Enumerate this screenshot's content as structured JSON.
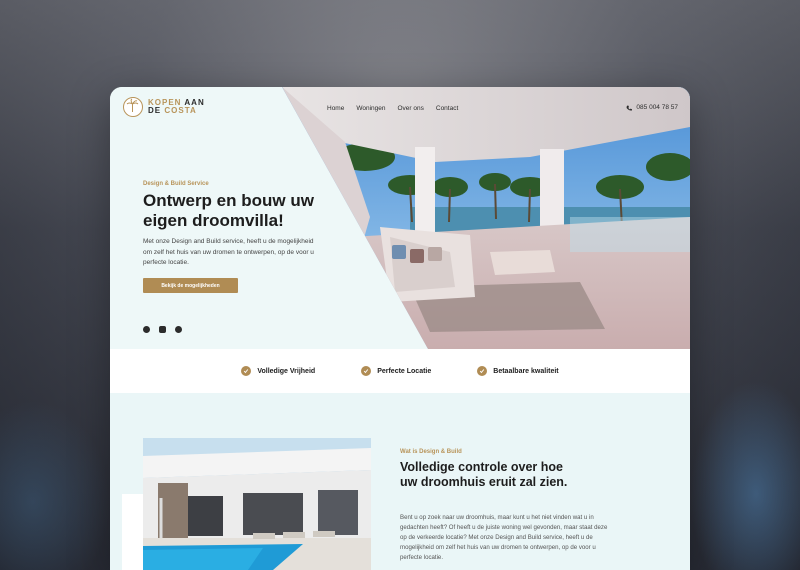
{
  "brand": {
    "line1_light": "KOPEN",
    "line1_dark": "AAN",
    "line2_dark": "DE",
    "line2_light": "COSTA",
    "accent_color": "#b8945a"
  },
  "nav": {
    "items": [
      {
        "label": "Home"
      },
      {
        "label": "Woningen"
      },
      {
        "label": "Over ons"
      },
      {
        "label": "Contact"
      }
    ],
    "phone": "085 004 78 57",
    "phone_icon": "phone-icon"
  },
  "hero": {
    "eyebrow": "Design & Build Service",
    "title": "Ontwerp en bouw uw eigen droomvilla!",
    "text": "Met onze Design and Build service, heeft u de mogelijkheid om zelf het huis van uw dromen te ontwerpen, op de voor u perfecte locatie.",
    "cta_label": "Bekijk de mogelijkheden",
    "socials": [
      "facebook-icon",
      "instagram-icon",
      "whatsapp-icon"
    ]
  },
  "features": [
    {
      "label": "Volledige Vrijheid",
      "icon": "check-circle-icon"
    },
    {
      "label": "Perfecte Locatie",
      "icon": "check-circle-icon"
    },
    {
      "label": "Betaalbare kwaliteit",
      "icon": "check-circle-icon"
    }
  ],
  "about": {
    "eyebrow": "Wat is Design & Build",
    "title": "Volledige controle over hoe uw droomhuis eruit zal zien.",
    "text": "Bent u op zoek naar uw droomhuis, maar kunt u het niet vinden wat u in gedachten heeft? Of heeft u de juiste woning wel gevonden, maar staat deze op de verkeerde locatie? Met onze Design and Build service, heeft u de mogelijkheid om zelf het huis van uw dromen te ontwerpen, op de voor u perfecte locatie."
  }
}
